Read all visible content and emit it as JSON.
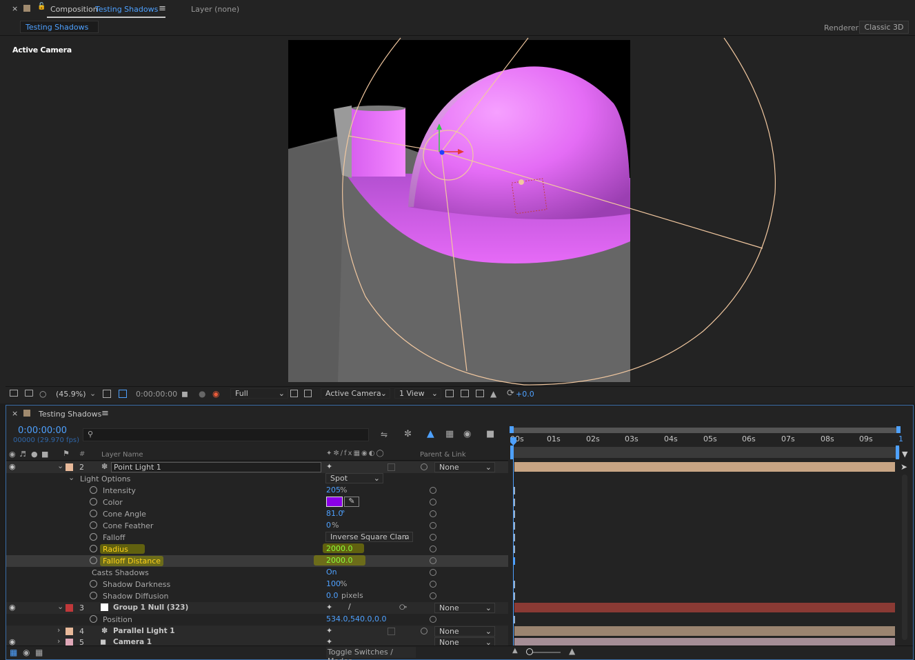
{
  "comp_panel": {
    "tab_close": "×",
    "tab_prefix": "Composition",
    "tab_title": "Testing Shadows",
    "tab_menu": "≡",
    "layer_tab": "Layer  (none)",
    "subtab": "Testing Shadows",
    "renderer_label": "Renderer:",
    "renderer_value": "Classic 3D",
    "viewer_label": "Active Camera"
  },
  "comp_toolbar": {
    "zoom": "(45.9%)",
    "timecode": "0:00:00:00",
    "resolution": "Full",
    "view": "Active Camera",
    "layout": "1 View",
    "exposure": "+0.0"
  },
  "timeline": {
    "tab_close": "×",
    "title": "Testing Shadows",
    "tab_menu": "≡",
    "current_time": "0:00:00:00",
    "frame_info": "00000 (29.970 fps)",
    "columns": {
      "hash": "#",
      "layer_name": "Layer Name",
      "parent": "Parent & Link"
    },
    "ruler": [
      "00s",
      "01s",
      "02s",
      "03s",
      "04s",
      "05s",
      "06s",
      "07s",
      "08s",
      "09s",
      "1"
    ],
    "layers": [
      {
        "num": "2",
        "name": "Point Light 1",
        "parent": "None",
        "color": "#e8b99a"
      },
      {
        "num": "3",
        "name": "Group 1 Null (323)",
        "parent": "None",
        "color": "#c0383a"
      },
      {
        "num": "4",
        "name": "Parallel Light 1",
        "parent": "None",
        "color": "#e8b99a"
      },
      {
        "num": "5",
        "name": "Camera 1",
        "parent": "None",
        "color": "#e0a8b8"
      }
    ],
    "light_options_label": "Light Options",
    "light_type": "Spot",
    "properties": [
      {
        "name": "Intensity",
        "value": "205",
        "unit": "%"
      },
      {
        "name": "Color",
        "value": "",
        "unit": ""
      },
      {
        "name": "Cone Angle",
        "value": "81.0",
        "unit": "°"
      },
      {
        "name": "Cone Feather",
        "value": "0",
        "unit": "%"
      },
      {
        "name": "Falloff",
        "value": "Inverse Square Clam",
        "unit": ""
      },
      {
        "name": "Radius",
        "value": "2000.0",
        "unit": ""
      },
      {
        "name": "Falloff Distance",
        "value": "2000.0",
        "unit": ""
      },
      {
        "name": "Casts Shadows",
        "value": "On",
        "unit": ""
      },
      {
        "name": "Shadow Darkness",
        "value": "100",
        "unit": "%"
      },
      {
        "name": "Shadow Diffusion",
        "value": "0.0",
        "unit": "pixels"
      }
    ],
    "position_label": "Position",
    "position_value": "534.0,540.0,0.0",
    "light_color": "#8a00e6",
    "toggle_label": "Toggle Switches / Modes"
  }
}
